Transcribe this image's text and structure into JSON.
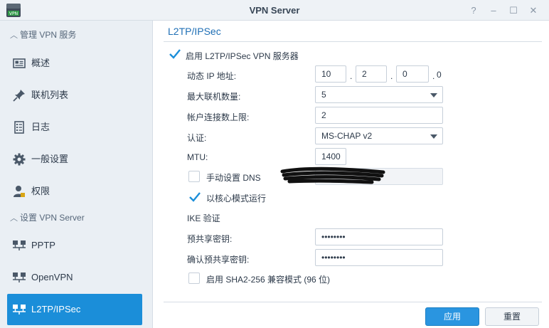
{
  "window": {
    "title": "VPN Server",
    "controls": [
      "?",
      "–",
      "☐",
      "✕"
    ]
  },
  "app_icon": {
    "badge": "VPN"
  },
  "sidebar": {
    "section_manage": "管理 VPN 服务",
    "section_setup": "设置 VPN Server",
    "manage_items": [
      {
        "label": "概述",
        "icon": "overview-icon"
      },
      {
        "label": "联机列表",
        "icon": "pin-icon"
      },
      {
        "label": "日志",
        "icon": "log-icon"
      },
      {
        "label": "一般设置",
        "icon": "gear-icon"
      },
      {
        "label": "权限",
        "icon": "user-icon"
      }
    ],
    "setup_items": [
      {
        "label": "PPTP",
        "icon": "network-icon"
      },
      {
        "label": "OpenVPN",
        "icon": "network-icon"
      },
      {
        "label": "L2TP/IPSec",
        "icon": "network-icon",
        "active": true
      }
    ]
  },
  "main": {
    "title": "L2TP/IPSec",
    "enable_label": "启用 L2TP/IPSec VPN 服务器",
    "enable_checked": true,
    "dynamic_ip_label": "动态 IP 地址:",
    "ip_octets": [
      "10",
      "2",
      "0"
    ],
    "ip_last": "0",
    "max_conn_label": "最大联机数量:",
    "max_conn_value": "5",
    "account_limit_label": "帐户连接数上限:",
    "account_limit_value": "2",
    "auth_label": "认证:",
    "auth_value": "MS-CHAP v2",
    "mtu_label": "MTU:",
    "mtu_value": "1400",
    "manual_dns_label": "手动设置 DNS",
    "manual_dns_checked": false,
    "kernel_mode_label": "以核心模式运行",
    "kernel_mode_checked": true,
    "ike_label": "IKE 验证",
    "psk_label": "预共享密钥:",
    "psk_value": "••••••••",
    "psk_confirm_label": "确认预共享密钥:",
    "psk_confirm_value": "••••••••",
    "sha2_label": "启用 SHA2-256 兼容模式 (96 位)",
    "sha2_checked": false
  },
  "footer": {
    "apply_label": "应用",
    "reset_label": "重置"
  },
  "colors": {
    "accent": "#1b8ed9",
    "title_blue": "#1f6fb5",
    "sidebar_bg": "#eaeff4"
  }
}
